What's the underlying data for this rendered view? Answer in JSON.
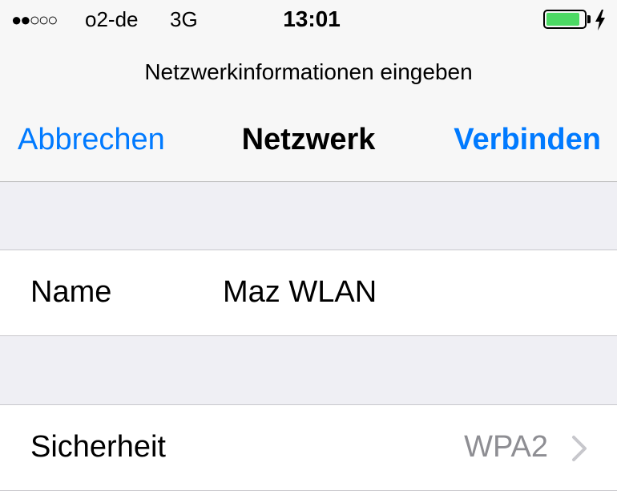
{
  "status_bar": {
    "signal": "●●○○○",
    "carrier": "o2-de",
    "network_type": "3G",
    "time": "13:01",
    "battery_level": 0.9,
    "battery_color": "#4cd964"
  },
  "header": {
    "prompt": "Netzwerkinformationen eingeben",
    "cancel_label": "Abbrechen",
    "title": "Netzwerk",
    "connect_label": "Verbinden"
  },
  "form": {
    "name": {
      "label": "Name",
      "value": "Maz WLAN"
    },
    "security": {
      "label": "Sicherheit",
      "value": "WPA2",
      "icon": "chevron-right-icon"
    }
  },
  "colors": {
    "accent": "#007aff",
    "secondary_text": "#8e8e93",
    "background": "#efeff4"
  }
}
